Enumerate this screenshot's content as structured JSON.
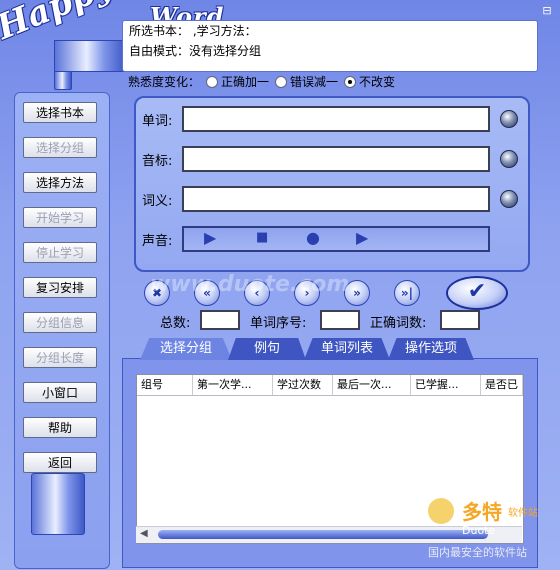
{
  "logo": {
    "part1": "Happy",
    "part2": "Word"
  },
  "window": {
    "minimize_glyph": "⊟"
  },
  "info": {
    "book_line": "所选书本：  ,学习方法：",
    "mode_line": "自由模式：没有选择分组"
  },
  "familiarity": {
    "label": "熟悉度变化：",
    "options": [
      {
        "label": "正确加一",
        "selected": false
      },
      {
        "label": "错误减一",
        "selected": false
      },
      {
        "label": "不改变",
        "selected": true
      }
    ]
  },
  "sidebar": {
    "buttons": [
      {
        "label": "选择书本",
        "enabled": true
      },
      {
        "label": "选择分组",
        "enabled": false
      },
      {
        "label": "选择方法",
        "enabled": true
      },
      {
        "label": "开始学习",
        "enabled": false
      },
      {
        "label": "停止学习",
        "enabled": false
      },
      {
        "label": "复习安排",
        "enabled": true
      },
      {
        "label": "分组信息",
        "enabled": false
      },
      {
        "label": "分组长度",
        "enabled": false
      },
      {
        "label": "小窗口",
        "enabled": true
      },
      {
        "label": "帮助",
        "enabled": true
      },
      {
        "label": "返回",
        "enabled": true
      }
    ]
  },
  "form": {
    "word_label": "单词:",
    "phonetic_label": "音标:",
    "meaning_label": "词义:",
    "sound_label": "声音:",
    "word_value": "",
    "phonetic_value": "",
    "meaning_value": ""
  },
  "player": {
    "play": "▶",
    "stop": "■",
    "record": "●",
    "next": "▶"
  },
  "nav": {
    "buttons": [
      "✖",
      "«",
      "‹",
      "›",
      "»",
      "»|"
    ],
    "confirm": "✔"
  },
  "watermark": "www.duote.com",
  "counters": {
    "total_label": "总数:",
    "index_label": "单词序号:",
    "correct_label": "正确词数:",
    "total_value": "",
    "index_value": "",
    "correct_value": ""
  },
  "tabs": [
    "选择分组",
    "例句",
    "单词列表",
    "操作选项"
  ],
  "table": {
    "columns": [
      "组号",
      "第一次学...",
      "学过次数",
      "最后一次...",
      "已学握...",
      "是否已"
    ]
  },
  "brand": {
    "a": "多特",
    "b": "软件站",
    "c": "Duote",
    "d": "国内最安全的软件站"
  }
}
